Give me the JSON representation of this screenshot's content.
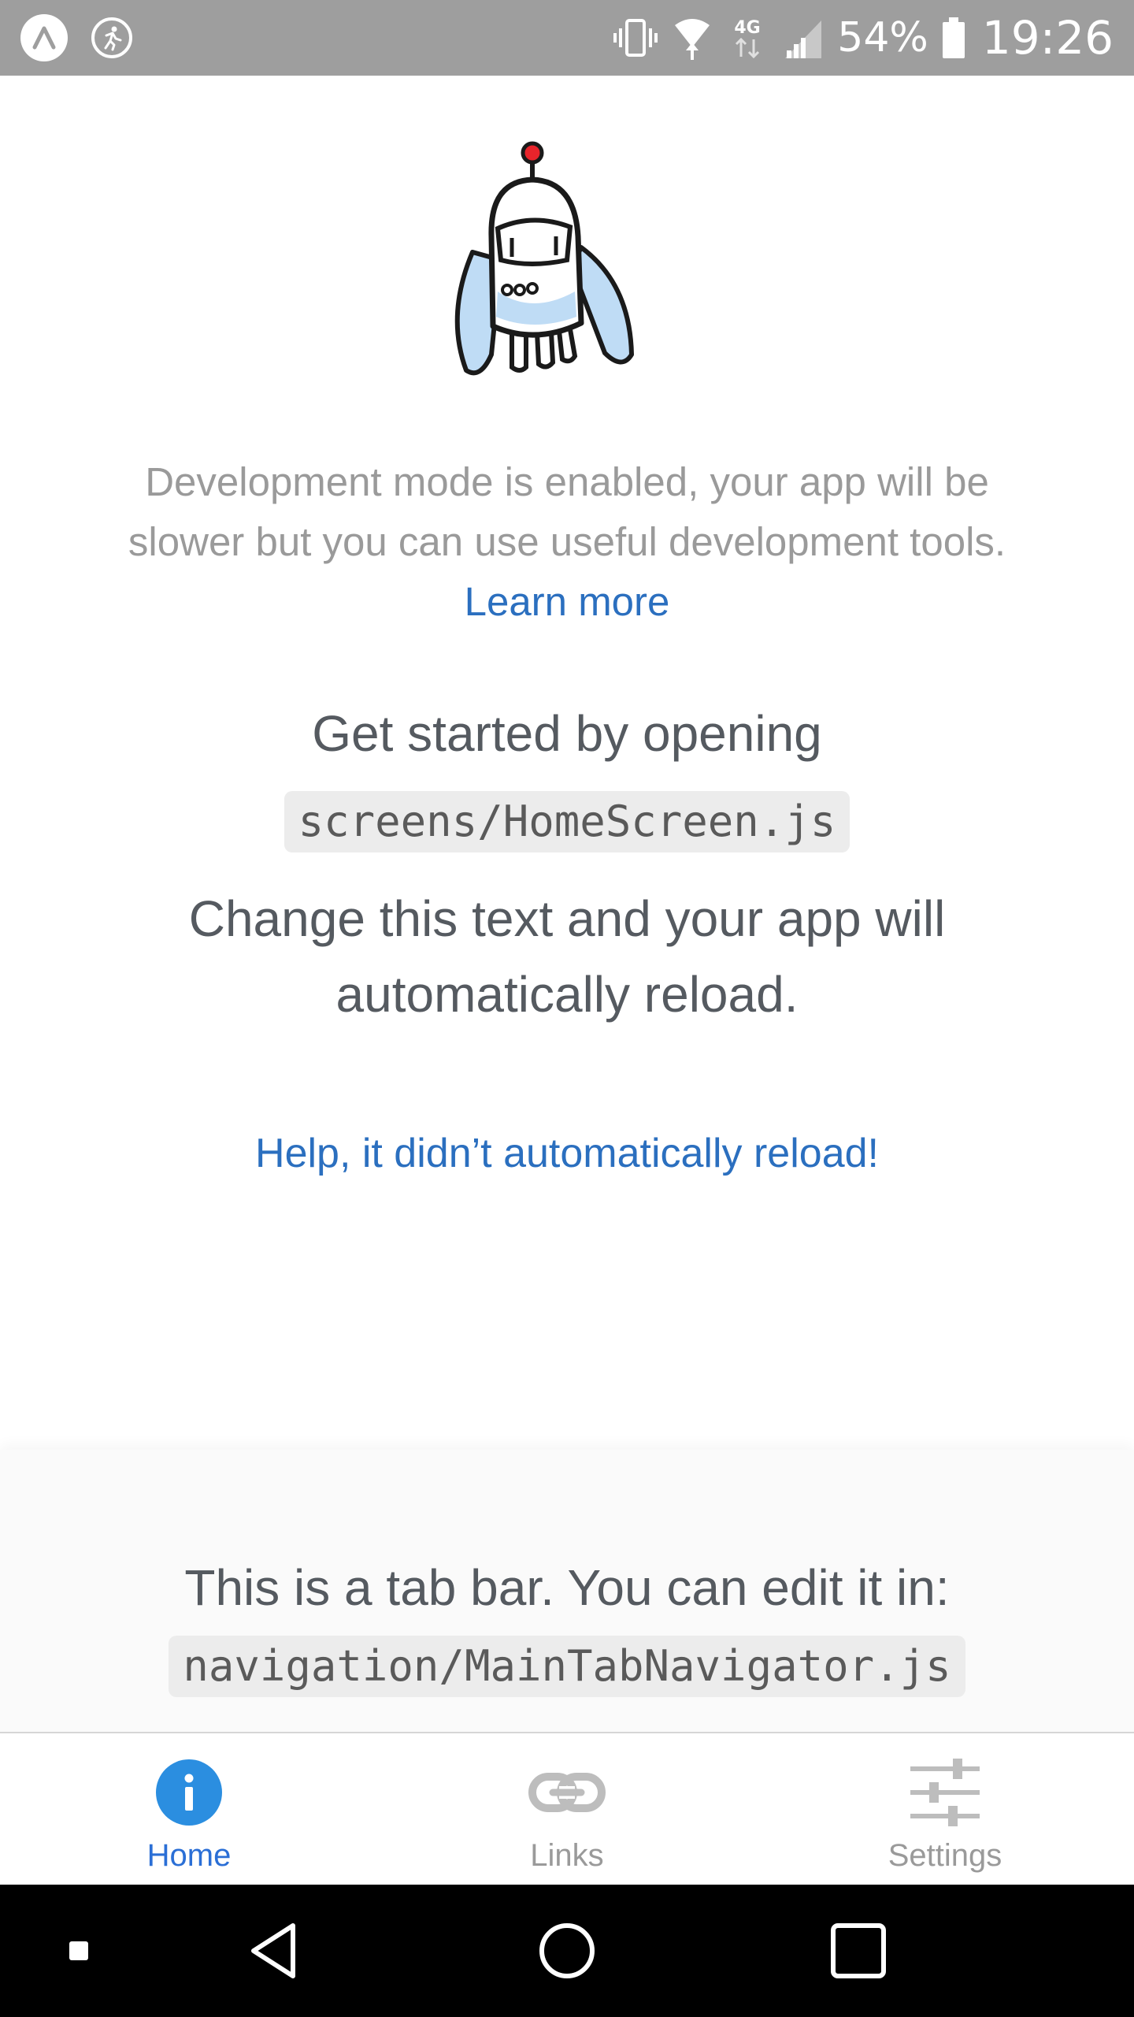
{
  "status_bar": {
    "battery_percent": "54%",
    "time": "19:26",
    "icons": [
      "app-logo-icon",
      "activity-icon",
      "vibrate-icon",
      "wifi-icon",
      "network-4g-icon",
      "signal-icon",
      "battery-icon"
    ],
    "network_label": "4G"
  },
  "main": {
    "dev_mode_text": "Development mode is enabled, your app will be slower but you can use useful development tools.",
    "learn_more_link": "Learn more",
    "get_started_text": "Get started by opening",
    "file_path": "screens/HomeScreen.js",
    "change_text": "Change this text and your app will automatically reload.",
    "help_link": "Help, it didn’t automatically reload!"
  },
  "tab_info": {
    "text": "This is a tab bar. You can edit it in:",
    "file_path": "navigation/MainTabNavigator.js"
  },
  "tab_bar": {
    "tabs": [
      {
        "label": "Home",
        "icon": "info-icon",
        "active": true
      },
      {
        "label": "Links",
        "icon": "link-icon",
        "active": false
      },
      {
        "label": "Settings",
        "icon": "sliders-icon",
        "active": false
      }
    ]
  },
  "colors": {
    "accent": "#2b6fd6",
    "link": "#2b6fbf",
    "status_bar_bg": "#9e9e9e",
    "text_muted": "#9a9a9a",
    "text_body": "#555a60"
  }
}
